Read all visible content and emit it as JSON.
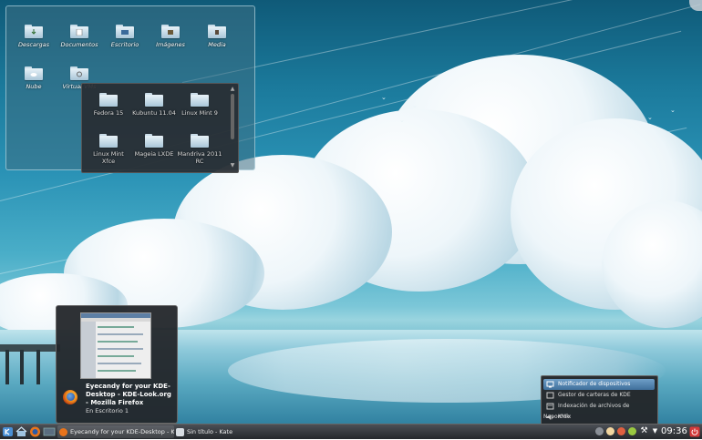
{
  "folder_view": {
    "items": [
      {
        "label": "Descargas",
        "icon": "folder-downloads-icon"
      },
      {
        "label": "Documentos",
        "icon": "folder-documents-icon"
      },
      {
        "label": "Escritorio",
        "icon": "folder-desktop-icon"
      },
      {
        "label": "Imágenes",
        "icon": "folder-images-icon"
      },
      {
        "label": "Media",
        "icon": "folder-media-icon"
      },
      {
        "label": "Nube",
        "icon": "folder-cloud-icon"
      },
      {
        "label": "Virtual VMs",
        "icon": "folder-virtual-icon"
      }
    ]
  },
  "folder_popup": {
    "items": [
      {
        "label": "Fedora 15"
      },
      {
        "label": "Kubuntu 11.04"
      },
      {
        "label": "Linux Mint 9"
      },
      {
        "label": "Linux Mint Xfce"
      },
      {
        "label": "Mageia LXDE"
      },
      {
        "label": "Mandriva 2011 RC"
      }
    ]
  },
  "task_tooltip": {
    "title": "Eyecandy for your KDE-Desktop - KDE-Look.org - Mozilla Firefox",
    "subtitle": "En Escritorio 1"
  },
  "systray_popup": {
    "items": [
      {
        "label": "Notificador de dispositivos",
        "icon": "device-notifier-icon",
        "selected": true
      },
      {
        "label": "Gestor de carteras de KDE",
        "icon": "wallet-icon",
        "selected": false
      },
      {
        "label": "Indexación de archivos de Nepomuk",
        "icon": "nepomuk-icon",
        "selected": false
      },
      {
        "label": "KMix",
        "icon": "speaker-icon",
        "selected": false
      }
    ]
  },
  "panel": {
    "tasks": [
      {
        "label": "Eyecandy for your KDE-Desktop - KDE",
        "icon": "firefox-icon"
      },
      {
        "label": "Sin título - Kate",
        "icon": "kate-icon"
      }
    ],
    "clock": "09:36"
  },
  "colors": {
    "panel": "#25282c",
    "selection": "#4f7fab",
    "folder": "#c9dce8"
  }
}
